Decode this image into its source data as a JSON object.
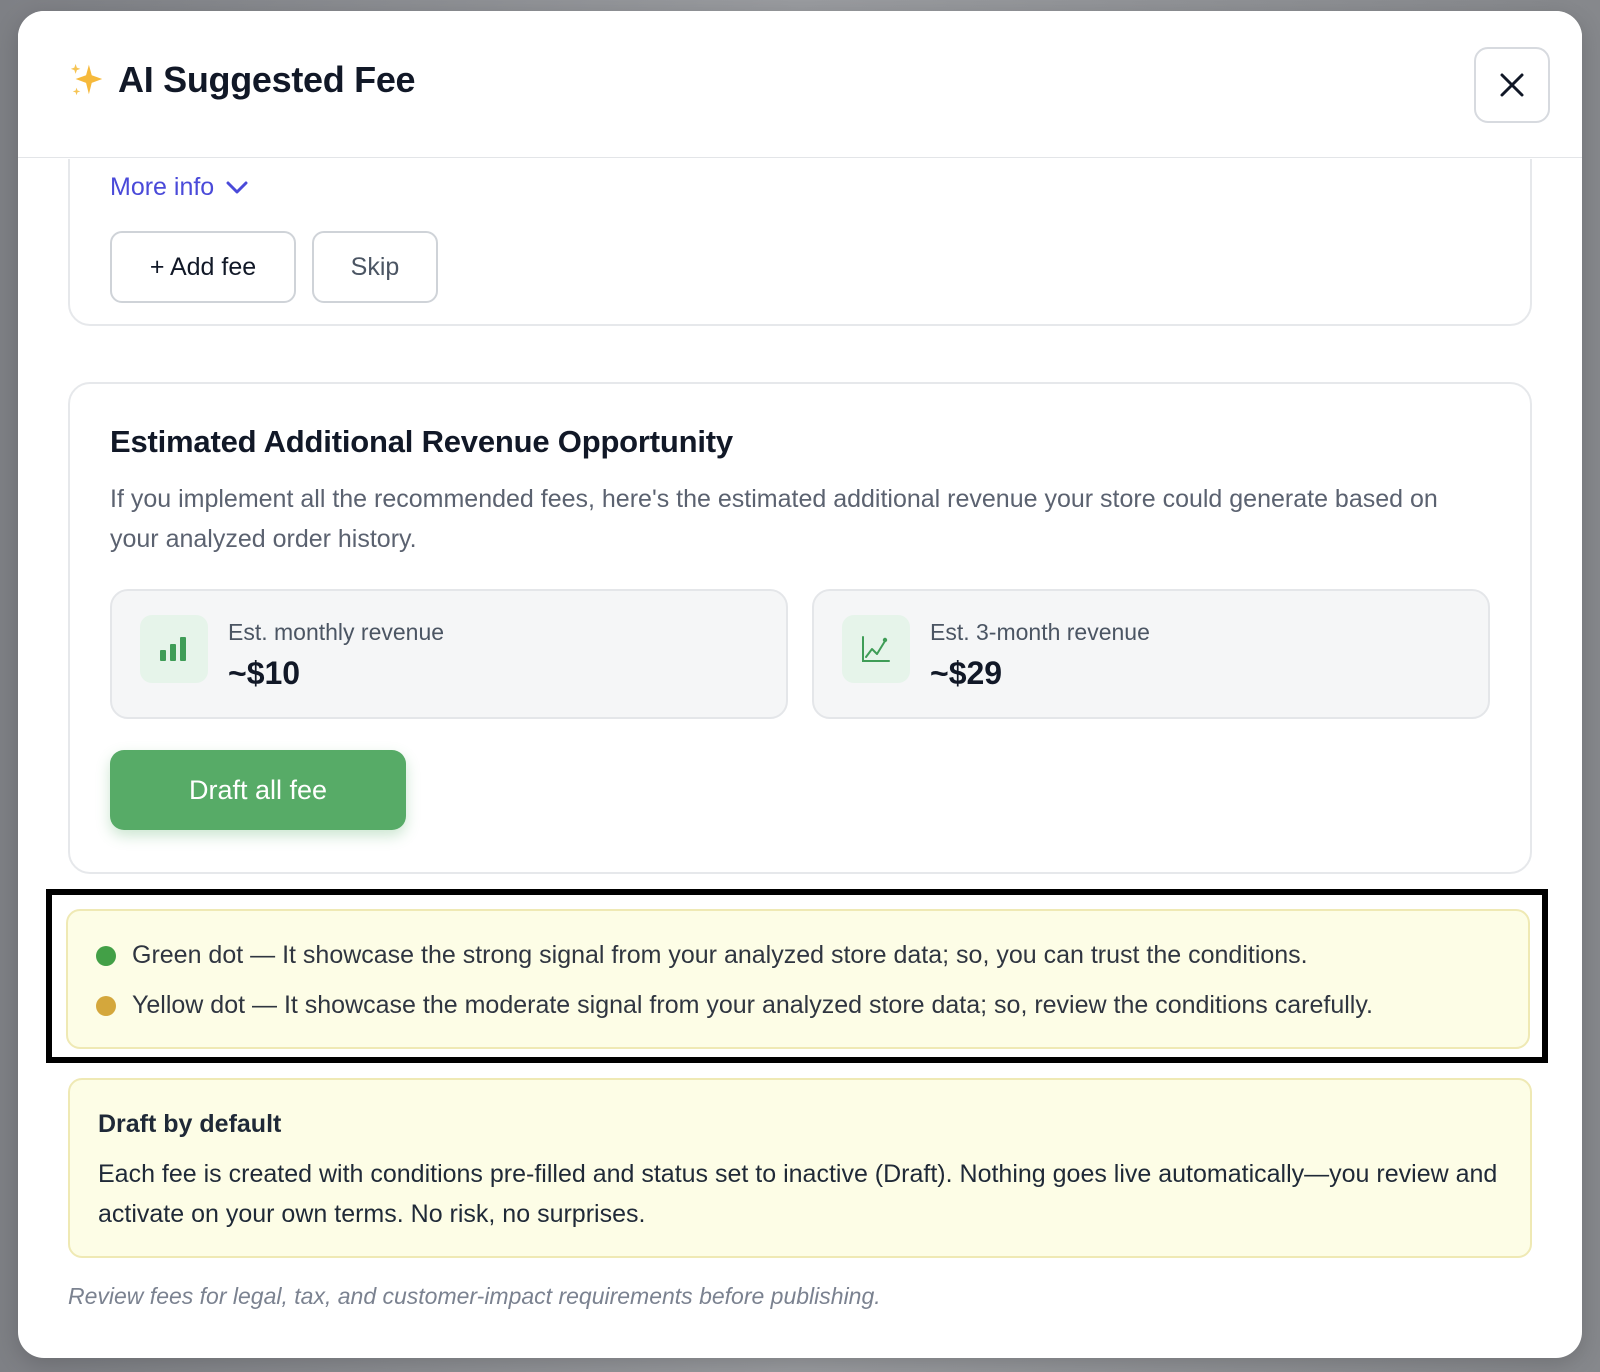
{
  "modal": {
    "title": "AI Suggested Fee",
    "title_icon": "sparkle-icon",
    "close_icon": "close-icon"
  },
  "fee_card": {
    "more_info_label": "More info",
    "add_fee_label": "+ Add fee",
    "skip_label": "Skip"
  },
  "revenue": {
    "title": "Estimated Additional Revenue Opportunity",
    "description": "If you implement all the recommended fees, here's the estimated additional revenue your store could generate based on your analyzed order history.",
    "stats": [
      {
        "label": "Est. monthly revenue",
        "value": "~$10",
        "icon": "bar-chart-icon"
      },
      {
        "label": "Est. 3-month revenue",
        "value": "~$29",
        "icon": "line-chart-icon"
      }
    ],
    "draft_all_label": "Draft all fee"
  },
  "legend": {
    "items": [
      {
        "text": "Green dot — It showcase the strong signal from your analyzed store data; so, you can trust the conditions.",
        "color": "#43a047"
      },
      {
        "text": "Yellow dot — It showcase the moderate signal from your analyzed store data; so, review the conditions carefully.",
        "color": "#d4a73c"
      }
    ]
  },
  "notice": {
    "title": "Draft by default",
    "body": "Each fee is created with conditions pre-filled and status set to inactive (Draft). Nothing goes live automatically—you review and activate on your own terms. No risk, no surprises."
  },
  "footer_note": "Review fees for legal, tax, and customer-impact requirements before publishing.",
  "colors": {
    "accent_link": "#4a4ad9",
    "primary_green": "#57ab67",
    "notice_bg": "#fdfde6"
  }
}
